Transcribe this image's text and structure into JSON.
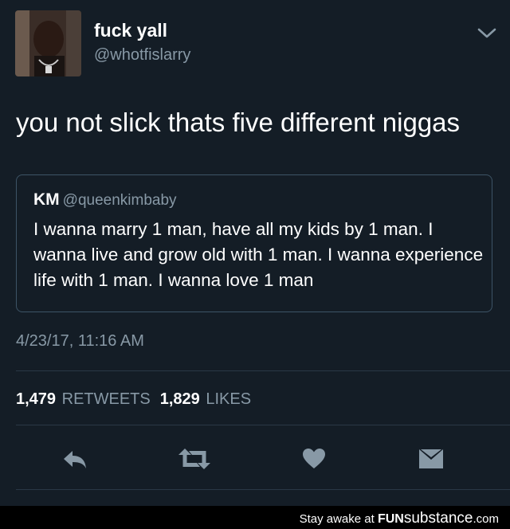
{
  "tweet": {
    "author_name": "fuck yall",
    "author_handle": "@whotfislarry",
    "text": "you not slick thats five different niggas",
    "timestamp": "4/23/17, 11:16 AM",
    "retweets_count": "1,479",
    "retweets_label": "RETWEETS",
    "likes_count": "1,829",
    "likes_label": "LIKES"
  },
  "quote": {
    "author_name": "KM",
    "author_handle": "@queenkimbaby",
    "text": "I wanna marry 1 man, have all my kids by 1 man. I wanna live and grow old with 1 man. I wanna experience life with 1 man. I wanna love 1 man"
  },
  "actions": {
    "reply_icon": "reply-icon",
    "retweet_icon": "retweet-icon",
    "like_icon": "heart-icon",
    "message_icon": "envelope-icon"
  },
  "footer": {
    "prefix": "Stay awake at",
    "brand_bold": "FUN",
    "brand_rest": "substance",
    "brand_suffix": ".com"
  },
  "colors": {
    "background": "#141d26",
    "secondary_text": "#8899a6",
    "action_icon": "#8899a6",
    "border": "#3d5466",
    "footer_bg": "#000000"
  }
}
